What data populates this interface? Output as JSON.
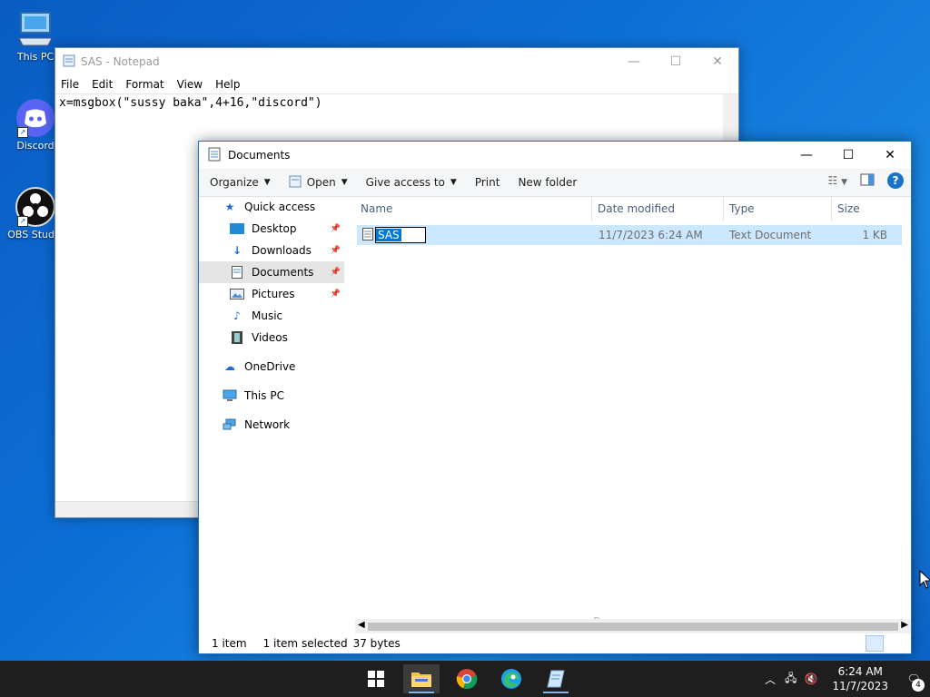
{
  "desktop": {
    "icons": [
      {
        "label": "This PC",
        "icon": "this-pc-icon"
      },
      {
        "label": "Discord",
        "icon": "discord-icon"
      },
      {
        "label": "OBS Studio",
        "icon": "obs-icon"
      }
    ]
  },
  "notepad": {
    "title": "SAS - Notepad",
    "menu": [
      "File",
      "Edit",
      "Format",
      "View",
      "Help"
    ],
    "content": "x=msgbox(\"sussy baka\",4+16,\"discord\")"
  },
  "explorer": {
    "title": "Documents",
    "toolbar": {
      "organize": "Organize",
      "open": "Open",
      "give_access": "Give access to",
      "print": "Print",
      "new_folder": "New folder",
      "help": "?"
    },
    "nav": {
      "quick_access": "Quick access",
      "items": [
        {
          "label": "Desktop",
          "pinned": true
        },
        {
          "label": "Downloads",
          "pinned": true
        },
        {
          "label": "Documents",
          "pinned": true
        },
        {
          "label": "Pictures",
          "pinned": true
        },
        {
          "label": "Music",
          "pinned": false
        },
        {
          "label": "Videos",
          "pinned": false
        }
      ],
      "onedrive": "OneDrive",
      "this_pc": "This PC",
      "network": "Network"
    },
    "columns": {
      "name": "Name",
      "date": "Date modified",
      "type": "Type",
      "size": "Size"
    },
    "files": [
      {
        "name": "SAS",
        "date": "11/7/2023 6:24 AM",
        "type": "Text Document",
        "size": "1 KB"
      }
    ],
    "rename_tip": "Rename",
    "status": {
      "count": "1 item",
      "selected": "1 item selected",
      "bytes": "37 bytes"
    }
  },
  "taskbar": {
    "time": "6:24 AM",
    "date": "11/7/2023",
    "notifications": "4"
  }
}
